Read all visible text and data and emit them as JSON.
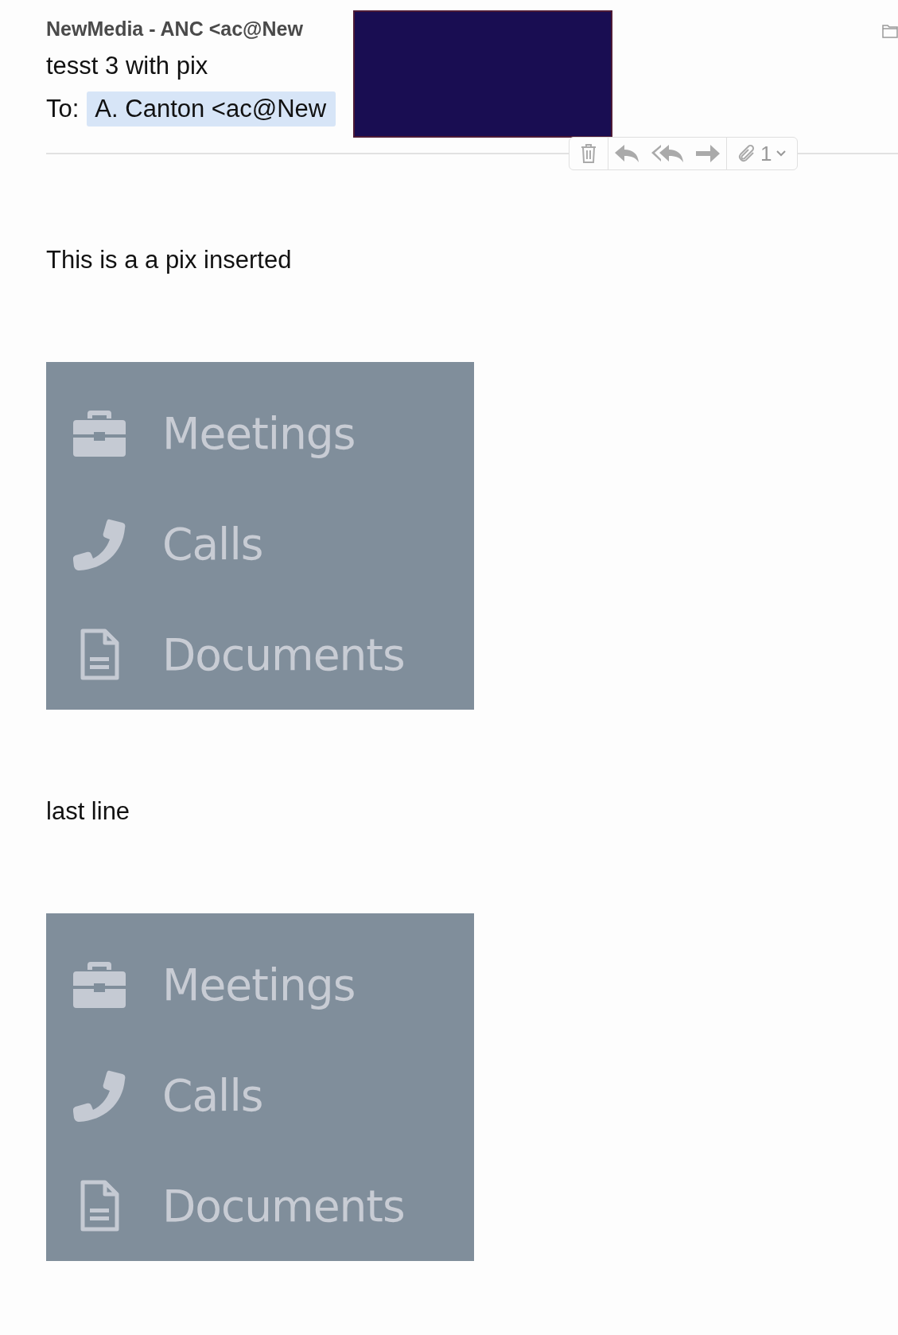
{
  "message": {
    "sender": "NewMedia - ANC <ac@New",
    "subject": "tesst 3 with pix",
    "to_label": "To:",
    "recipient": "A. Canton <ac@New"
  },
  "toolbar": {
    "attachment_count": "1"
  },
  "body": [
    {
      "kind": "text",
      "text": "This is a a pix inserted"
    },
    {
      "kind": "image",
      "items": [
        {
          "kind": "briefcase",
          "label": "Meetings"
        },
        {
          "kind": "phone",
          "label": "Calls"
        },
        {
          "kind": "document",
          "label": "Documents"
        }
      ]
    },
    {
      "kind": "text",
      "text": "last line"
    },
    {
      "kind": "image",
      "items": [
        {
          "kind": "briefcase",
          "label": "Meetings"
        },
        {
          "kind": "phone",
          "label": "Calls"
        },
        {
          "kind": "document",
          "label": "Documents"
        }
      ]
    }
  ]
}
